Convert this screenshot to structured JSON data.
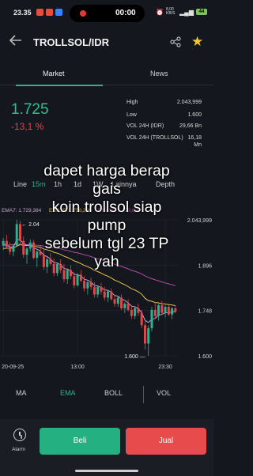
{
  "status_bar": {
    "time": "23.35",
    "recording_time": "00:00",
    "network": "8,00 KB/S",
    "battery": "44"
  },
  "header": {
    "title": "TROLLSOL/IDR"
  },
  "tabs": [
    {
      "label": "Market",
      "active": true
    },
    {
      "label": "News",
      "active": false
    }
  ],
  "ticker": {
    "price": "1.725",
    "change": "-13,1 %",
    "price_color": "#2fc08f",
    "change_color": "#e0474a"
  },
  "stats": {
    "high_label": "High",
    "high_value": "2.043,999",
    "low_label": "Low",
    "low_value": "1.600",
    "vol_idr_label": "VOL 24H (IDR)",
    "vol_idr_value": "29,66 Bn",
    "vol_coin_label": "VOL 24H (TROLLSOL)",
    "vol_coin_value_1": "16,18",
    "vol_coin_value_2": "Mn"
  },
  "timeframes": [
    "Line",
    "15m",
    "1h",
    "1d",
    "1W",
    "Lainnya",
    "Depth"
  ],
  "timeframe_active": "15m",
  "ema": {
    "ema7": "EMA7: 1.729,384",
    "ema25": "EMA25: 1.756,306",
    "ema99": "EMA99: 1.879,605",
    "ema7_color": "#c9a3d9",
    "ema25_color": "#e7c34d",
    "ema99_color": "#b04ba8"
  },
  "chart_data": {
    "type": "candlestick",
    "y_ticks": [
      "2.043,999",
      "1.896",
      "1.748",
      "1.600"
    ],
    "x_ticks": [
      "20-09-25",
      "13:00",
      "23:30"
    ],
    "annotations": {
      "high_mark": "2.04",
      "low_mark": "1.600"
    },
    "ylim": [
      1600,
      2044
    ],
    "candles": [
      [
        1960,
        1985,
        1945,
        1975
      ],
      [
        1975,
        1995,
        1950,
        1955
      ],
      [
        1955,
        1970,
        1930,
        1940
      ],
      [
        1940,
        1965,
        1925,
        1960
      ],
      [
        1960,
        2044,
        1955,
        2030
      ],
      [
        2030,
        2040,
        1960,
        1975
      ],
      [
        1975,
        1990,
        1920,
        1930
      ],
      [
        1930,
        1955,
        1900,
        1950
      ],
      [
        1950,
        1980,
        1940,
        1970
      ],
      [
        1970,
        1978,
        1915,
        1920
      ],
      [
        1920,
        1945,
        1890,
        1940
      ],
      [
        1940,
        1960,
        1925,
        1930
      ],
      [
        1930,
        1950,
        1880,
        1890
      ],
      [
        1890,
        1925,
        1870,
        1915
      ],
      [
        1915,
        1935,
        1895,
        1900
      ],
      [
        1900,
        1918,
        1860,
        1870
      ],
      [
        1870,
        1905,
        1860,
        1900
      ],
      [
        1900,
        1915,
        1870,
        1880
      ],
      [
        1880,
        1900,
        1840,
        1850
      ],
      [
        1850,
        1885,
        1835,
        1880
      ],
      [
        1880,
        1895,
        1850,
        1860
      ],
      [
        1860,
        1875,
        1820,
        1830
      ],
      [
        1830,
        1870,
        1825,
        1865
      ],
      [
        1865,
        1880,
        1840,
        1845
      ],
      [
        1845,
        1860,
        1810,
        1820
      ],
      [
        1820,
        1845,
        1800,
        1840
      ],
      [
        1840,
        1855,
        1815,
        1825
      ],
      [
        1825,
        1840,
        1790,
        1800
      ],
      [
        1800,
        1830,
        1790,
        1825
      ],
      [
        1825,
        1838,
        1800,
        1810
      ],
      [
        1810,
        1825,
        1780,
        1790
      ],
      [
        1790,
        1815,
        1775,
        1810
      ],
      [
        1810,
        1820,
        1780,
        1785
      ],
      [
        1785,
        1800,
        1760,
        1770
      ],
      [
        1770,
        1795,
        1760,
        1790
      ],
      [
        1790,
        1800,
        1750,
        1755
      ],
      [
        1755,
        1775,
        1740,
        1770
      ],
      [
        1770,
        1785,
        1745,
        1750
      ],
      [
        1750,
        1765,
        1720,
        1730
      ],
      [
        1730,
        1760,
        1720,
        1755
      ],
      [
        1755,
        1770,
        1730,
        1740
      ],
      [
        1740,
        1750,
        1690,
        1700
      ],
      [
        1700,
        1720,
        1620,
        1640
      ],
      [
        1640,
        1700,
        1600,
        1690
      ],
      [
        1690,
        1760,
        1680,
        1750
      ],
      [
        1750,
        1775,
        1720,
        1730
      ],
      [
        1730,
        1770,
        1715,
        1765
      ],
      [
        1765,
        1780,
        1735,
        1740
      ],
      [
        1740,
        1765,
        1725,
        1760
      ],
      [
        1760,
        1770,
        1730,
        1735
      ],
      [
        1735,
        1760,
        1720,
        1755
      ],
      [
        1755,
        1765,
        1740,
        1745
      ]
    ],
    "ema7_line": [
      1965,
      1962,
      1955,
      1956,
      1978,
      1980,
      1965,
      1960,
      1962,
      1952,
      1948,
      1942,
      1928,
      1924,
      1916,
      1904,
      1903,
      1897,
      1885,
      1883,
      1877,
      1865,
      1865,
      1860,
      1850,
      1847,
      1841,
      1830,
      1828,
      1823,
      1815,
      1814,
      1807,
      1797,
      1795,
      1785,
      1781,
      1773,
      1762,
      1760,
      1755,
      1741,
      1716,
      1709,
      1719,
      1722,
      1733,
      1735,
      1741,
      1740,
      1744,
      1744
    ],
    "ema25_line": [
      1950,
      1951,
      1951,
      1952,
      1958,
      1963,
      1961,
      1960,
      1961,
      1958,
      1956,
      1954,
      1949,
      1946,
      1943,
      1938,
      1935,
      1931,
      1925,
      1921,
      1916,
      1910,
      1906,
      1901,
      1895,
      1891,
      1886,
      1879,
      1875,
      1870,
      1864,
      1860,
      1854,
      1847,
      1843,
      1837,
      1832,
      1826,
      1819,
      1815,
      1809,
      1801,
      1788,
      1780,
      1778,
      1774,
      1773,
      1770,
      1769,
      1767,
      1766,
      1764
    ],
    "ema99_line": [
      1960,
      1961,
      1962,
      1963,
      1964,
      1965,
      1964,
      1963,
      1963,
      1962,
      1961,
      1960,
      1958,
      1957,
      1955,
      1953,
      1951,
      1949,
      1946,
      1944,
      1941,
      1938,
      1936,
      1933,
      1930,
      1927,
      1924,
      1920,
      1917,
      1914,
      1910,
      1907,
      1903,
      1899,
      1896,
      1892,
      1888,
      1884,
      1879,
      1876,
      1872,
      1867,
      1861,
      1856,
      1852,
      1848,
      1845,
      1841,
      1838,
      1835,
      1832,
      1829
    ]
  },
  "overlay_text": [
    "dapet harga berap",
    "gais",
    "koin trollsol siap",
    "pump",
    "sebelum tgl 23 TP",
    "yah"
  ],
  "indicators": [
    {
      "label": "MA",
      "active": false
    },
    {
      "label": "EMA",
      "active": true
    },
    {
      "label": "BOLL",
      "active": false
    },
    {
      "label": "VOL",
      "active": false
    }
  ],
  "bottom": {
    "alarm_label": "Alarm",
    "buy_label": "Beli",
    "sell_label": "Jual"
  }
}
